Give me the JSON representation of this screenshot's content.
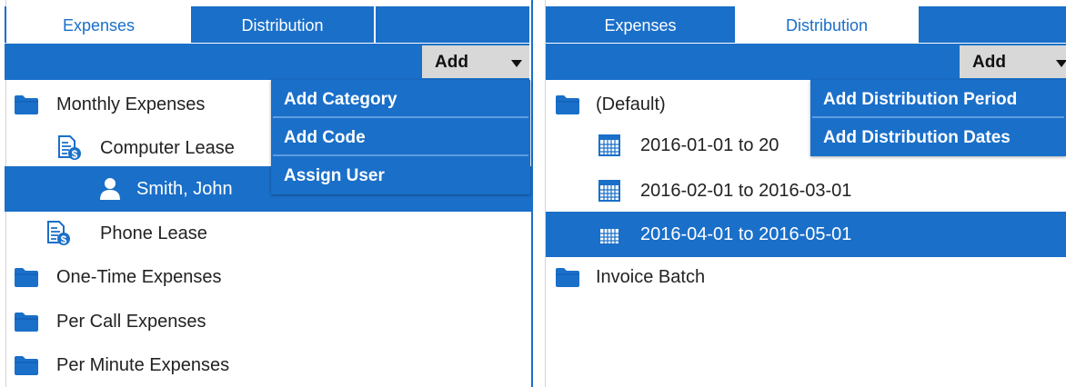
{
  "colors": {
    "accent": "#1a6fc9",
    "button_bg": "#d8d8d8"
  },
  "left": {
    "tabs": [
      {
        "label": "Expenses",
        "active": false
      },
      {
        "label": "Distribution",
        "active": true
      }
    ],
    "add_button": {
      "label": "Add"
    },
    "tree": [
      {
        "label": "Monthly Expenses",
        "icon": "folder-icon"
      },
      {
        "label": "Computer Lease",
        "icon": "document-dollar-icon"
      },
      {
        "label": "Smith, John",
        "icon": "user-icon",
        "selected": true
      },
      {
        "label": "Phone Lease",
        "icon": "document-dollar-icon"
      },
      {
        "label": "One-Time Expenses",
        "icon": "folder-icon"
      },
      {
        "label": "Per Call Expenses",
        "icon": "folder-icon"
      },
      {
        "label": "Per Minute Expenses",
        "icon": "folder-icon"
      }
    ],
    "menu": [
      "Add Category",
      "Add Code",
      "Assign User"
    ]
  },
  "right": {
    "tabs": [
      {
        "label": "Expenses",
        "active": true
      },
      {
        "label": "Distribution",
        "active": false
      }
    ],
    "add_button": {
      "label": "Add"
    },
    "tree": [
      {
        "label": "(Default)",
        "icon": "folder-icon"
      },
      {
        "label": "2016-01-01 to 20",
        "icon": "calendar-icon"
      },
      {
        "label": "2016-02-01 to 2016-03-01",
        "icon": "calendar-icon"
      },
      {
        "label": "2016-04-01 to 2016-05-01",
        "icon": "calendar-icon",
        "selected": true
      },
      {
        "label": "Invoice Batch",
        "icon": "folder-icon"
      }
    ],
    "menu": [
      "Add Distribution Period",
      "Add Distribution Dates"
    ]
  }
}
